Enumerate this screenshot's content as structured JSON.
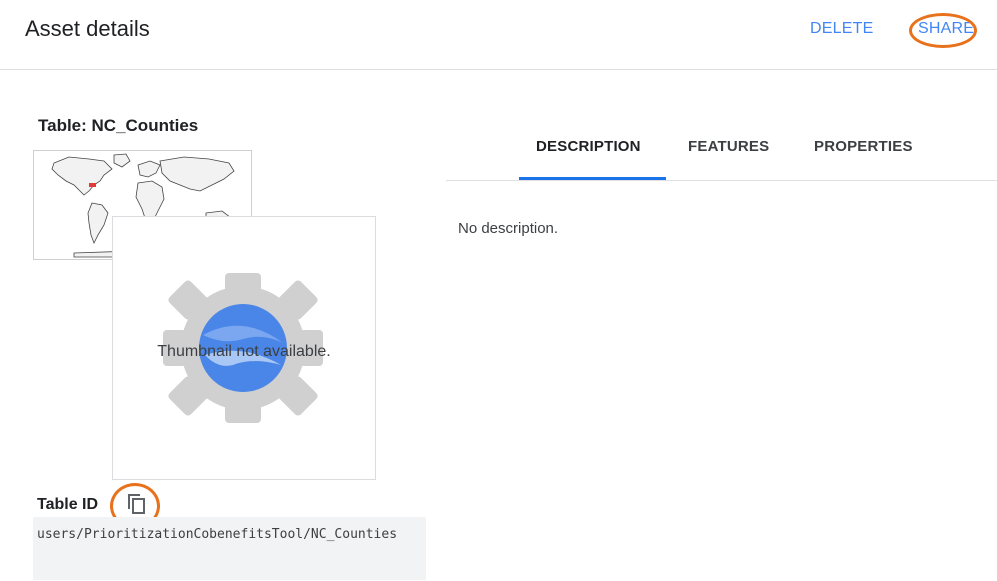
{
  "header": {
    "title": "Asset details",
    "delete_label": "DELETE",
    "share_label": "SHARE"
  },
  "asset": {
    "table_label": "Table: NC_Counties",
    "thumbnail_text": "Thumbnail not available.",
    "id_label": "Table ID",
    "id_value": "users/PrioritizationCobenefitsTool/NC_Counties"
  },
  "tabs": [
    {
      "label": "DESCRIPTION",
      "active": true
    },
    {
      "label": "FEATURES",
      "active": false
    },
    {
      "label": "PROPERTIES",
      "active": false
    }
  ],
  "description": {
    "text": "No description."
  },
  "icons": {
    "copy": "copy-icon",
    "map": "world-map-thumbnail",
    "placeholder": "earth-engine-gear-icon"
  },
  "colors": {
    "accent": "#4285f4",
    "tab_indicator": "#1a73e8",
    "highlight_ring": "#e8711c"
  }
}
